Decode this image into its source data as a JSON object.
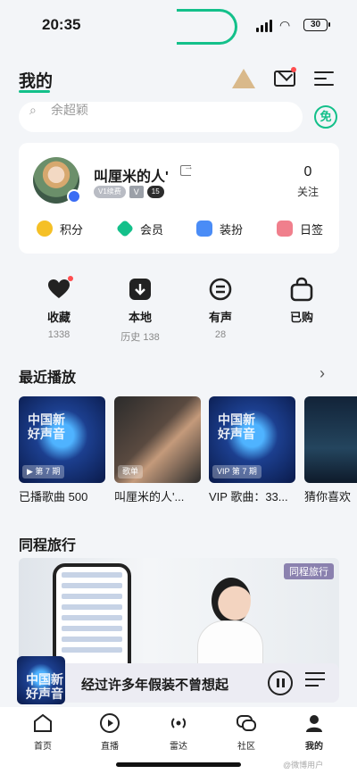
{
  "status": {
    "time": "20:35",
    "battery": "30"
  },
  "header": {
    "title": "我的"
  },
  "search": {
    "placeholder": "余超颖",
    "free_label": "免"
  },
  "profile": {
    "name": "叫厘米的人'",
    "vip_badge": "V1续费",
    "v_badge": "V",
    "level_badge": "15",
    "follow_count": "0",
    "follow_label": "关注",
    "quick": [
      {
        "label": "积分",
        "color": "#f5c026"
      },
      {
        "label": "会员",
        "color": "#13c08a"
      },
      {
        "label": "装扮",
        "color": "#4a8cf6"
      },
      {
        "label": "日签",
        "color": "#f07f8c"
      }
    ]
  },
  "collections": [
    {
      "label": "收藏",
      "sub": "1338",
      "icon": "heart-icon"
    },
    {
      "label": "本地",
      "sub": "历史 138",
      "icon": "download-icon"
    },
    {
      "label": "有声",
      "sub": "28",
      "icon": "audio-icon"
    },
    {
      "label": "已购",
      "sub": "",
      "icon": "bag-icon"
    }
  ],
  "recent": {
    "title": "最近播放",
    "items": [
      {
        "label": "已播歌曲 500",
        "tag": "▶ 第 7 期"
      },
      {
        "label": "叫厘米的人'...",
        "tag": "歌单"
      },
      {
        "label": "VIP 歌曲：33...",
        "tag": "VIP 第 7 期"
      },
      {
        "label": "猜你喜欢",
        "tag": ""
      }
    ]
  },
  "travel": {
    "title": "同程旅行",
    "brand": "同程旅行"
  },
  "player": {
    "song": "经过许多年假装不曾想起"
  },
  "tabs": [
    {
      "label": "首页",
      "icon": "home-icon"
    },
    {
      "label": "直播",
      "icon": "live-icon"
    },
    {
      "label": "雷达",
      "icon": "radar-icon"
    },
    {
      "label": "社区",
      "icon": "community-icon"
    },
    {
      "label": "我的",
      "icon": "user-icon"
    }
  ],
  "watermark": "@微博用户"
}
